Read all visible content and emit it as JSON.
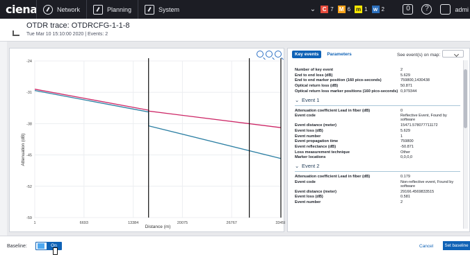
{
  "app": {
    "brand": "ciena",
    "nav": [
      {
        "label": "Network",
        "icon": "network-icon"
      },
      {
        "label": "Planning",
        "icon": "planning-icon"
      },
      {
        "label": "System",
        "icon": "system-icon"
      }
    ],
    "alarms": [
      {
        "badge": "C",
        "count": "7",
        "color": "#e74b3c"
      },
      {
        "badge": "M",
        "count": "6",
        "color": "#f7a21b"
      },
      {
        "badge": "m",
        "count": "1",
        "color": "#f7e700"
      },
      {
        "badge": "w",
        "count": "2",
        "color": "#2c6fbc"
      }
    ],
    "alarm_extra": "0",
    "user": "admi"
  },
  "page": {
    "title": "OTDR trace: OTDRCFG-1-1-8",
    "subtitle": "Tue Mar 10 15:10:00 2020 | Events: 2"
  },
  "chart_data": {
    "type": "line",
    "xlabel": "Distance (m)",
    "ylabel": "Attenuation (dB)",
    "x_ticks": [
      "1",
      "6693",
      "13384",
      "20075",
      "26767",
      "33458"
    ],
    "y_ticks": [
      "-24",
      "-31",
      "-38",
      "-45",
      "-52",
      "-59"
    ],
    "xlim": [
      1,
      33458
    ],
    "ylim": [
      -59,
      -24
    ],
    "series": [
      {
        "color": "#cc2565",
        "x": [
          1,
          15471,
          15471,
          33458
        ],
        "y": [
          -30.3,
          -35.0,
          -35.2,
          -38.9
        ]
      },
      {
        "color": "#2c7fa3",
        "x": [
          1,
          15471,
          15471,
          33458
        ],
        "y": [
          -30.6,
          -35.4,
          -38.5,
          -45.8
        ]
      }
    ],
    "markers_x": [
      15471,
      29166,
      33458
    ],
    "grid": true
  },
  "right": {
    "tabs": [
      "Key events",
      "Parameters"
    ],
    "map_label": "See event(s) on map:",
    "summary": [
      {
        "label": "Number of key event",
        "value": "2"
      },
      {
        "label": "End to end loss (dB)",
        "value": "5.629"
      },
      {
        "label": "End to end marker position (160 pico-seconds)",
        "value": "759800,1430438"
      },
      {
        "label": "Optical return loss (dB)",
        "value": "50.871"
      },
      {
        "label": "Optical return loss marker positions (160 pico-seconds)",
        "value": "0,979344"
      }
    ],
    "event1": {
      "title": "Event 1",
      "rows": [
        {
          "label": "Attenuation coefficient Lead in fiber (dB)",
          "value": "0"
        },
        {
          "label": "Event code",
          "value": "Reflective Event, Found by software"
        },
        {
          "label": "Event distance (meter)",
          "value": "15471.578077711172"
        },
        {
          "label": "Event loss (dB)",
          "value": "5.629"
        },
        {
          "label": "Event number",
          "value": "1"
        },
        {
          "label": "Event propagation time",
          "value": "759800"
        },
        {
          "label": "Event reflectance (dB)",
          "value": "-50.871"
        },
        {
          "label": "Loss measurement technique",
          "value": "Other"
        },
        {
          "label": "Marker locations",
          "value": "0,0,0,0"
        }
      ]
    },
    "event2": {
      "title": "Event 2",
      "rows": [
        {
          "label": "Attenuation coefficient Lead in fiber (dB)",
          "value": "0.179"
        },
        {
          "label": "Event code",
          "value": "Non-reflective event, Found by software"
        },
        {
          "label": "Event distance (meter)",
          "value": "29166.4569833515"
        },
        {
          "label": "Event loss (dB)",
          "value": "0.581"
        },
        {
          "label": "Event number",
          "value": "2"
        }
      ]
    }
  },
  "footer": {
    "baseline_label": "Baseline:",
    "toggle_label": "On",
    "cancel_label": "Cancel",
    "set_baseline_label": "Set baseline"
  }
}
